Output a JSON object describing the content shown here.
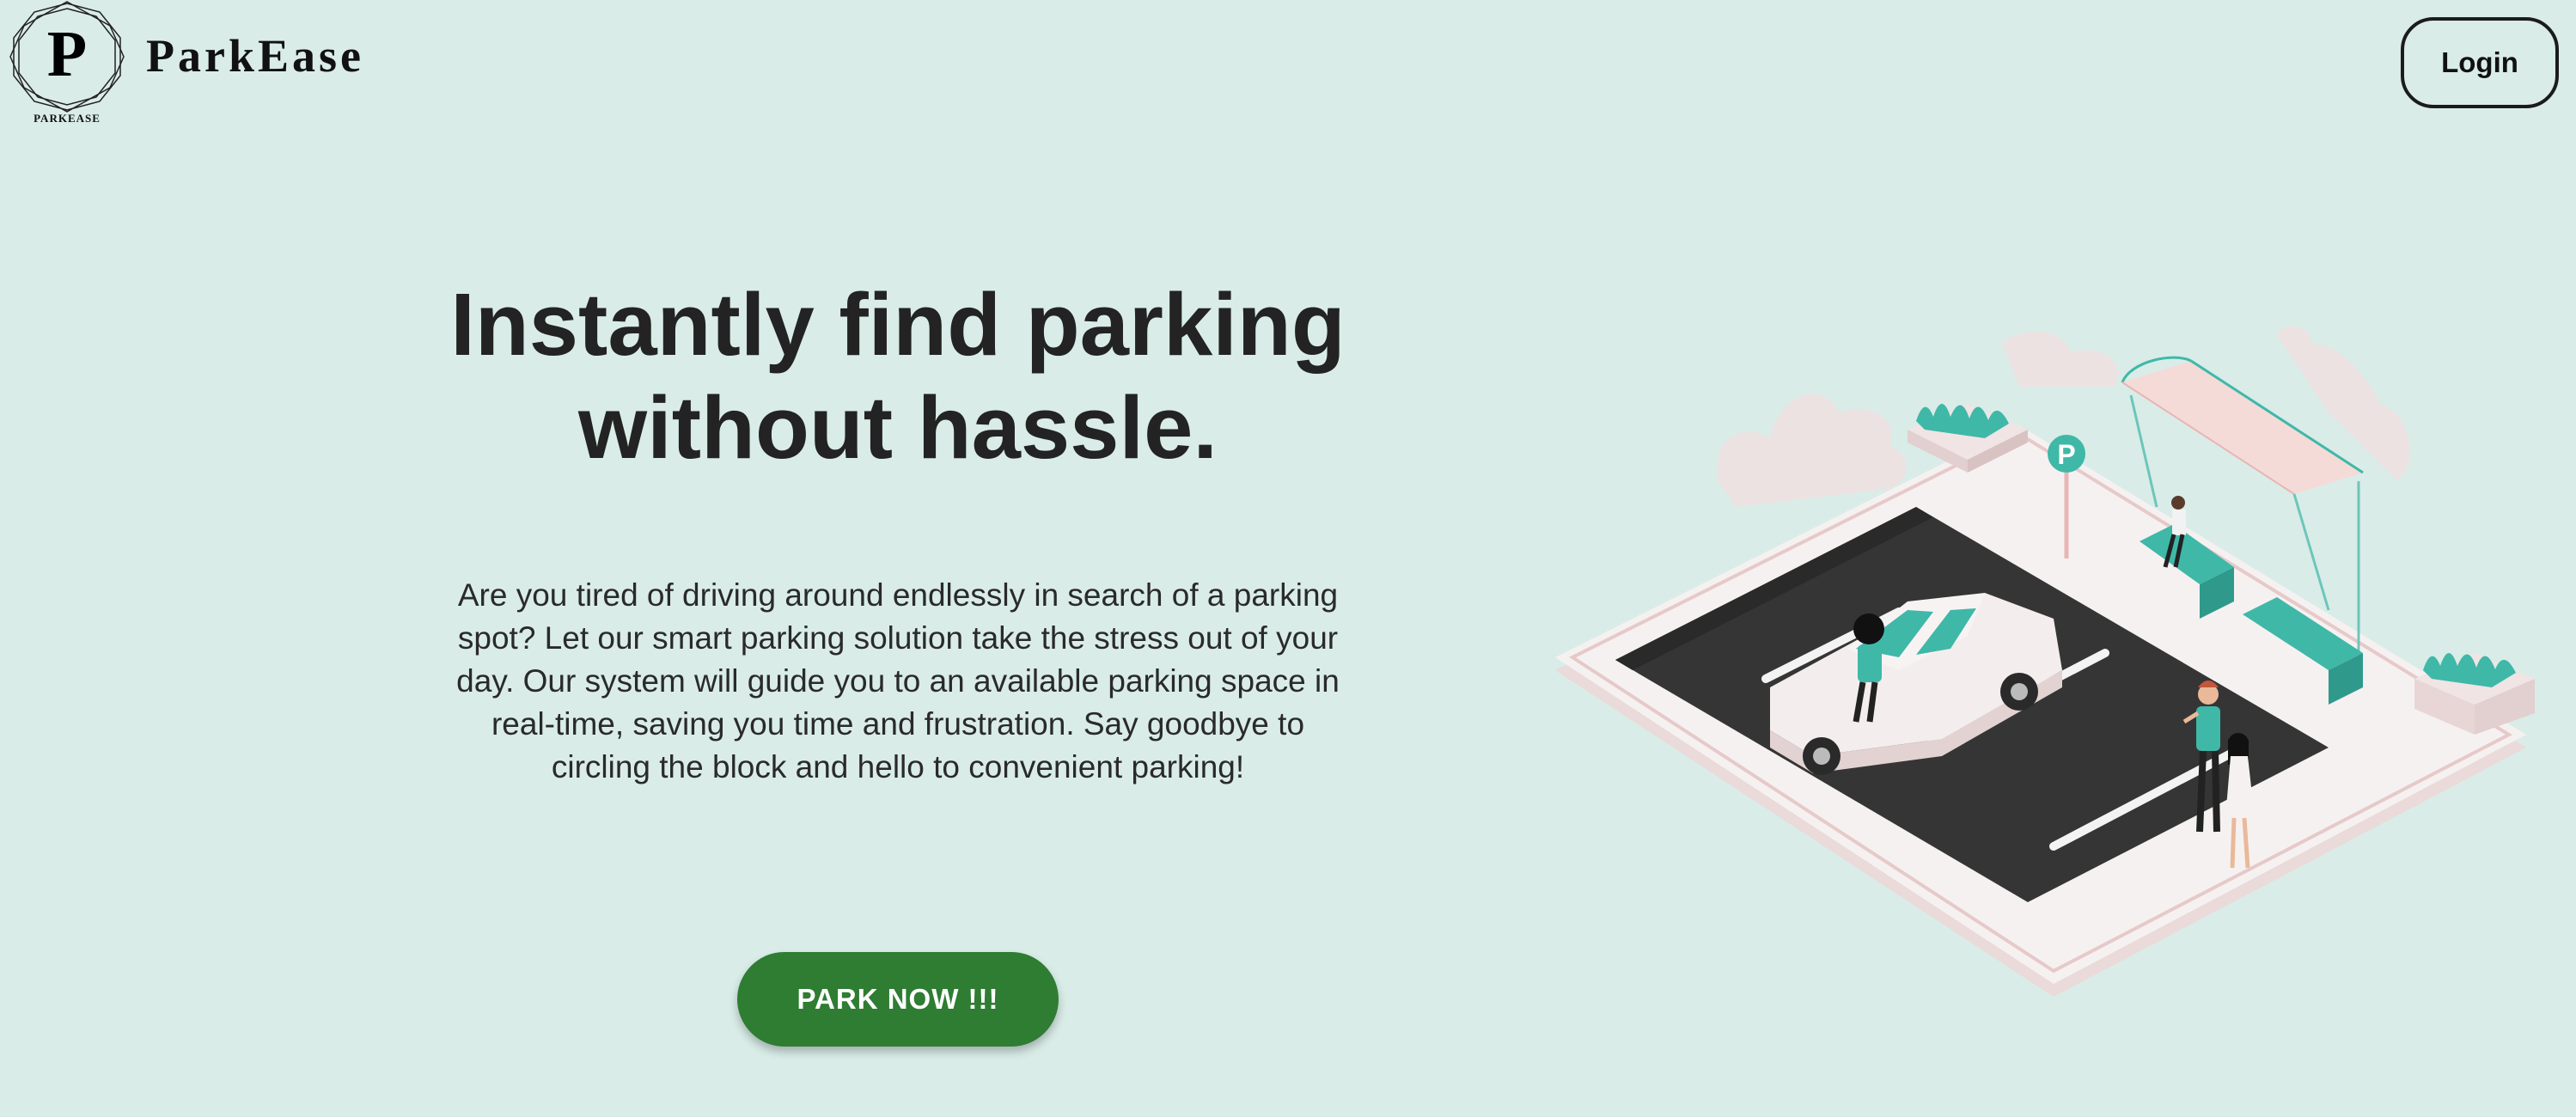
{
  "app": {
    "brand_name": "ParkEase",
    "logo_letter": "P",
    "logo_caption": "PARKEASE"
  },
  "header": {
    "login_label": "Login"
  },
  "hero": {
    "title_line1": "Instantly find parking",
    "title_line2": "without hassle.",
    "body": "Are you tired of driving around endlessly in search of a parking spot? Let our smart parking solution take the stress out of your day. Our system will guide you to an available parking space in real-time, saving you time and frustration. Say goodbye to circling the block and hello to convenient parking!",
    "cta_label": "PARK NOW !!!"
  },
  "illustration": {
    "sign_letter": "P"
  },
  "colors": {
    "background": "#d9ece8",
    "cta": "#2e7d32",
    "accent_teal": "#3fb8a8",
    "asphalt": "#333333"
  },
  "icons": {
    "logo": "parkease-logo-icon",
    "illustration": "parking-lot-illustration"
  }
}
